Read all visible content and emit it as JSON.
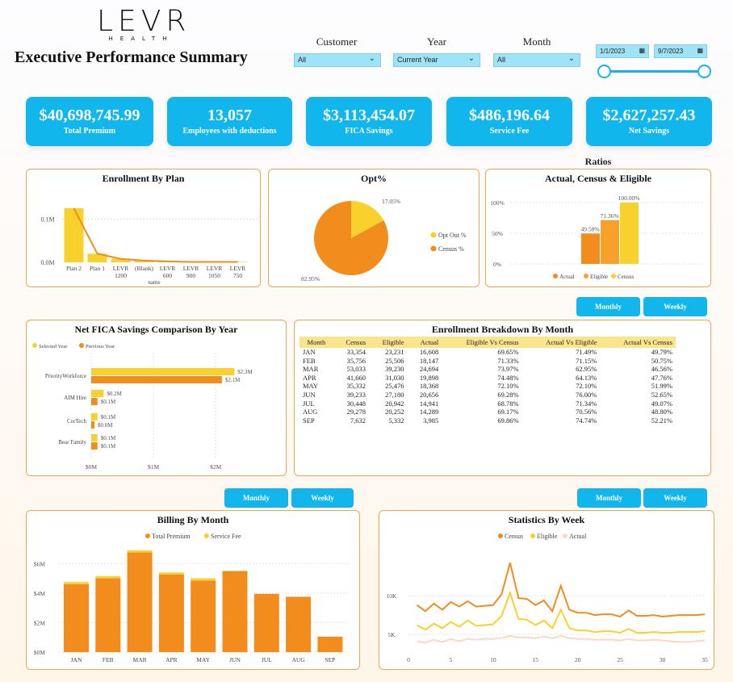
{
  "header": {
    "logo_main": "LEVR",
    "logo_sub": "HEALTH",
    "title": "Executive Performance Summary"
  },
  "filters": {
    "customer": {
      "label": "Customer",
      "value": "All"
    },
    "year": {
      "label": "Year",
      "value": "Current Year"
    },
    "month": {
      "label": "Month",
      "value": "All"
    },
    "date_start": "1/1/2023",
    "date_end": "9/7/2023"
  },
  "kpis": [
    {
      "value": "$40,698,745.99",
      "label": "Total Premium"
    },
    {
      "value": "13,057",
      "label": "Employees with deductions"
    },
    {
      "value": "$3,113,454.07",
      "label": "FICA Savings"
    },
    {
      "value": "$486,196.64",
      "label": "Service Fee"
    },
    {
      "value": "$2,627,257.43",
      "label": "Net Savings"
    }
  ],
  "colors": {
    "accent": "#11b6ec",
    "orange": "#f28c1c",
    "yellow": "#f9d12c",
    "light_orange": "#f7a12a",
    "peach": "#f9d9c4",
    "border": "#f0a656"
  },
  "enrollment_by_plan": {
    "title": "Enrollment By Plan",
    "xlabel": "name",
    "y_ticks": [
      "0.1M",
      "0.0M"
    ],
    "chart_data": {
      "type": "bar",
      "categories": [
        "Plan 2",
        "Plan 1",
        "LEVR 1200",
        "(Blank)",
        "LEVR 600",
        "LEVR 900",
        "LEVR 1050",
        "LEVR 750"
      ],
      "category_lines": [
        [
          "Plan 2"
        ],
        [
          "Plan 1"
        ],
        [
          "LEVR",
          "1200"
        ],
        [
          "(Blank)"
        ],
        [
          "LEVR",
          "600"
        ],
        [
          "LEVR",
          "900"
        ],
        [
          "LEVR",
          "1050"
        ],
        [
          "LEVR",
          "750"
        ]
      ],
      "values": [
        0.125,
        0.02,
        0.008,
        0.004,
        0.002,
        0.001,
        0.001,
        0.001
      ],
      "line_values": [
        0.125,
        0.02,
        0.008,
        0.004,
        0.002,
        0.001,
        0.001,
        0.001
      ],
      "ylim": [
        0,
        0.14
      ]
    }
  },
  "opt_pct": {
    "title": "Opt%",
    "chart_data": {
      "type": "pie",
      "labels": [
        "Opt Out %",
        "Census %"
      ],
      "values": [
        17.05,
        82.95
      ],
      "data_labels": [
        "17.05%",
        "82.95%"
      ]
    }
  },
  "ratios": {
    "heading": "Ratios",
    "title": "Actual, Census & Eligible",
    "y_ticks": [
      "100%",
      "50%",
      "0%"
    ],
    "chart_data": {
      "type": "bar",
      "series": [
        {
          "name": "Actual",
          "value": 49.58,
          "label": "49.58%"
        },
        {
          "name": "Eligible",
          "value": 71.36,
          "label": "71.36%"
        },
        {
          "name": "Census",
          "value": 100.0,
          "label": "100.00%"
        }
      ],
      "ylim": [
        0,
        100
      ]
    }
  },
  "net_fica": {
    "title": "Net FICA Savings Comparison By Year",
    "legend": [
      "Selected Year",
      "Previous Year"
    ],
    "x_ticks": [
      "$0M",
      "$1M",
      "$2M"
    ],
    "chart_data": {
      "type": "bar",
      "orientation": "horizontal",
      "categories": [
        "PriorityWorkforce",
        "AIM Hire",
        "CorTech",
        "Bear Family"
      ],
      "series": [
        {
          "name": "Selected Year",
          "values": [
            2.3,
            0.2,
            0.1,
            0.1
          ],
          "labels": [
            "$2.3M",
            "$0.2M",
            "$0.1M",
            "$0.1M"
          ]
        },
        {
          "name": "Previous Year",
          "values": [
            2.1,
            0.1,
            0.0,
            0.1
          ],
          "labels": [
            "$2.1M",
            "$0.1M",
            "$0.0M",
            "$0.1M"
          ]
        }
      ],
      "xlim": [
        0,
        2.4
      ]
    }
  },
  "enrollment_breakdown": {
    "title": "Enrollment Breakdown By Month",
    "buttons": [
      "Monthly",
      "Weekly"
    ],
    "columns": [
      "Month",
      "Census",
      "Eligible",
      "Actual",
      "Eligible Vs Census",
      "Actual Vs Eligible",
      "Actual Vs Census"
    ],
    "rows": [
      [
        "JAN",
        "33,354",
        "23,231",
        "16,608",
        "69.65%",
        "71.49%",
        "49.79%"
      ],
      [
        "FEB",
        "35,756",
        "25,506",
        "18,147",
        "71.33%",
        "71.15%",
        "50.75%"
      ],
      [
        "MAR",
        "53,033",
        "39,230",
        "24,694",
        "73.97%",
        "62.95%",
        "46.56%"
      ],
      [
        "APR",
        "41,660",
        "31,030",
        "19,898",
        "74.48%",
        "64.13%",
        "47.76%"
      ],
      [
        "MAY",
        "35,332",
        "25,476",
        "18,368",
        "72.10%",
        "72.10%",
        "51.99%"
      ],
      [
        "JUN",
        "39,233",
        "27,180",
        "20,656",
        "69.28%",
        "76.00%",
        "52.65%"
      ],
      [
        "JUL",
        "30,448",
        "20,942",
        "14,941",
        "68.78%",
        "71.34%",
        "49.07%"
      ],
      [
        "AUG",
        "29,278",
        "20,252",
        "14,289",
        "69.17%",
        "70.56%",
        "48.80%"
      ],
      [
        "SEP",
        "7,632",
        "5,332",
        "3,985",
        "69.86%",
        "74.74%",
        "52.21%"
      ]
    ]
  },
  "billing": {
    "title": "Billing By Month",
    "buttons": [
      "Monthly",
      "Weekly"
    ],
    "legend": [
      "Total Premium",
      "Service Fee"
    ],
    "y_ticks": [
      "$6M",
      "$4M",
      "$2M",
      "$0M"
    ],
    "chart_data": {
      "type": "bar",
      "stacked": true,
      "categories": [
        "JAN",
        "FEB",
        "MAR",
        "APR",
        "MAY",
        "JUN",
        "JUL",
        "AUG",
        "SEP"
      ],
      "series": [
        {
          "name": "Total Premium",
          "values": [
            4.6,
            5.0,
            6.75,
            5.25,
            4.85,
            5.5,
            3.95,
            3.75,
            1.05
          ]
        },
        {
          "name": "Service Fee",
          "values": [
            0.15,
            0.15,
            0.15,
            0.15,
            0.15,
            0.0,
            0.0,
            0.0,
            0.0
          ]
        }
      ],
      "ylim": [
        0,
        7
      ]
    }
  },
  "stats_week": {
    "title": "Statistics By Week",
    "buttons": [
      "Monthly",
      "Weekly"
    ],
    "legend": [
      "Census",
      "Eligible",
      "Actual"
    ],
    "y_ticks": [
      "10K",
      "5K"
    ],
    "x_ticks": [
      "0",
      "5",
      "10",
      "15",
      "20",
      "25",
      "30",
      "35"
    ],
    "chart_data": {
      "type": "line",
      "x": [
        1,
        2,
        3,
        4,
        5,
        6,
        7,
        8,
        9,
        10,
        11,
        12,
        13,
        14,
        15,
        16,
        17,
        18,
        19,
        20,
        21,
        22,
        23,
        24,
        25,
        26,
        27,
        28,
        29,
        30,
        31,
        32,
        33,
        34,
        35
      ],
      "series": [
        {
          "name": "Census",
          "values": [
            8.8,
            8.0,
            9.0,
            8.2,
            9.2,
            8.6,
            9.3,
            8.6,
            8.7,
            8.8,
            10.2,
            14.3,
            9.7,
            9.6,
            8.8,
            9.4,
            8.0,
            11.3,
            8.2,
            7.8,
            7.8,
            7.5,
            7.6,
            7.6,
            7.3,
            8.1,
            7.4,
            7.4,
            7.5,
            7.3,
            7.4,
            7.5,
            7.5,
            7.5,
            7.6
          ]
        },
        {
          "name": "Eligible",
          "values": [
            6.2,
            5.6,
            6.4,
            5.8,
            6.6,
            6.0,
            6.8,
            6.1,
            6.2,
            6.3,
            7.4,
            10.4,
            7.0,
            6.9,
            6.2,
            6.8,
            5.8,
            8.2,
            5.8,
            5.5,
            5.5,
            5.3,
            5.4,
            5.4,
            5.2,
            5.7,
            5.2,
            5.2,
            5.3,
            5.2,
            5.2,
            5.3,
            5.3,
            5.3,
            5.4
          ]
        },
        {
          "name": "Actual",
          "values": [
            4.1,
            3.9,
            4.3,
            4.0,
            4.4,
            4.1,
            4.4,
            4.3,
            4.4,
            4.4,
            4.5,
            4.8,
            4.6,
            4.6,
            4.5,
            4.7,
            4.5,
            4.8,
            4.5,
            4.4,
            4.4,
            4.3,
            4.3,
            4.3,
            4.2,
            4.4,
            4.2,
            4.2,
            4.3,
            4.2,
            4.1,
            4.0,
            4.0,
            4.1,
            4.2
          ]
        }
      ],
      "ylim": [
        3,
        16
      ]
    }
  }
}
